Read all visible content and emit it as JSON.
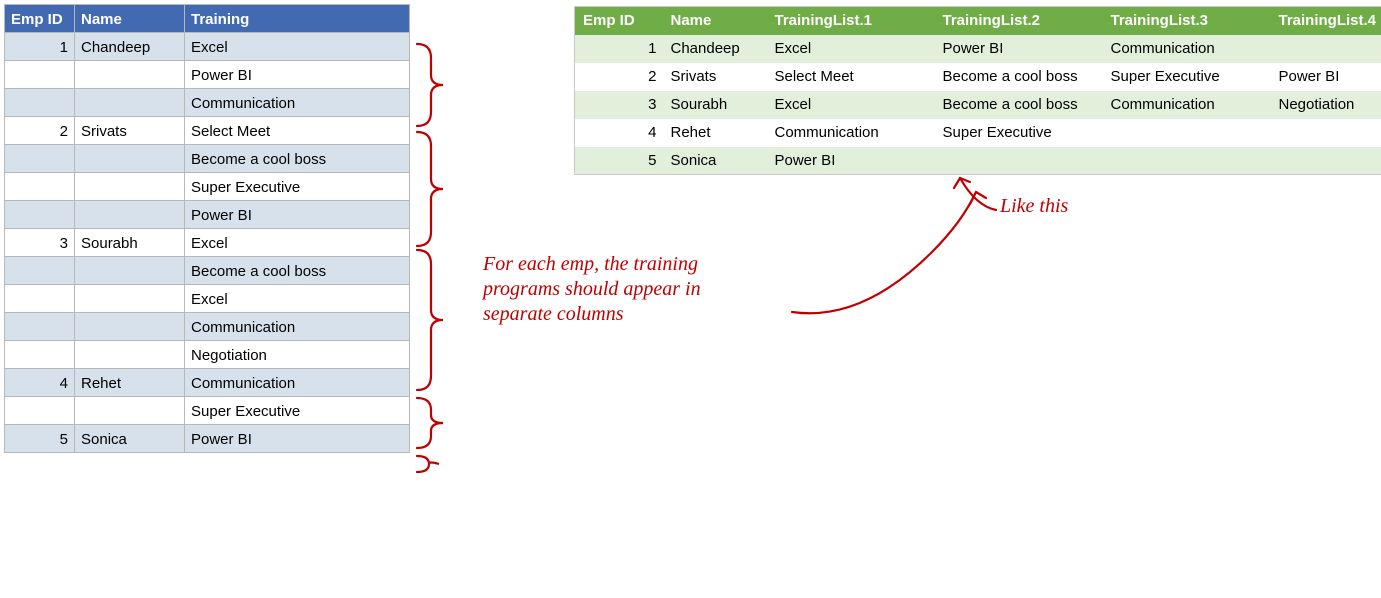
{
  "src": {
    "headers": {
      "emp": "Emp ID",
      "name": "Name",
      "train": "Training"
    },
    "rows": [
      {
        "emp": "1",
        "name": "Chandeep",
        "train": "Excel"
      },
      {
        "emp": "",
        "name": "",
        "train": "Power BI"
      },
      {
        "emp": "",
        "name": "",
        "train": "Communication"
      },
      {
        "emp": "2",
        "name": "Srivats",
        "train": "Select Meet"
      },
      {
        "emp": "",
        "name": "",
        "train": "Become a cool boss"
      },
      {
        "emp": "",
        "name": "",
        "train": "Super Executive"
      },
      {
        "emp": "",
        "name": "",
        "train": "Power BI"
      },
      {
        "emp": "3",
        "name": "Sourabh",
        "train": "Excel"
      },
      {
        "emp": "",
        "name": "",
        "train": "Become a cool boss"
      },
      {
        "emp": "",
        "name": "",
        "train": "Excel"
      },
      {
        "emp": "",
        "name": "",
        "train": "Communication"
      },
      {
        "emp": "",
        "name": "",
        "train": "Negotiation"
      },
      {
        "emp": "4",
        "name": "Rehet",
        "train": "Communication"
      },
      {
        "emp": "",
        "name": "",
        "train": "Super Executive"
      },
      {
        "emp": "5",
        "name": "Sonica",
        "train": "Power BI"
      }
    ]
  },
  "dst": {
    "headers": {
      "emp": "Emp ID",
      "name": "Name",
      "t1": "TrainingList.1",
      "t2": "TrainingList.2",
      "t3": "TrainingList.3",
      "t4": "TrainingList.4"
    },
    "rows": [
      {
        "emp": "1",
        "name": "Chandeep",
        "t1": "Excel",
        "t2": "Power BI",
        "t3": "Communication",
        "t4": ""
      },
      {
        "emp": "2",
        "name": "Srivats",
        "t1": "Select Meet",
        "t2": "Become a cool boss",
        "t3": "Super Executive",
        "t4": "Power BI"
      },
      {
        "emp": "3",
        "name": "Sourabh",
        "t1": "Excel",
        "t2": "Become a cool boss",
        "t3": "Communication",
        "t4": "Negotiation"
      },
      {
        "emp": "4",
        "name": "Rehet",
        "t1": "Communication",
        "t2": "Super Executive",
        "t3": "",
        "t4": ""
      },
      {
        "emp": "5",
        "name": "Sonica",
        "t1": "Power BI",
        "t2": "",
        "t3": "",
        "t4": ""
      }
    ]
  },
  "annot": {
    "main": "For each emp, the training\nprograms should appear in\nseparate columns",
    "like": "Like this"
  },
  "colors": {
    "accent_src": "#426ab3",
    "accent_dst": "#70ad47",
    "annot": "#c00000"
  }
}
